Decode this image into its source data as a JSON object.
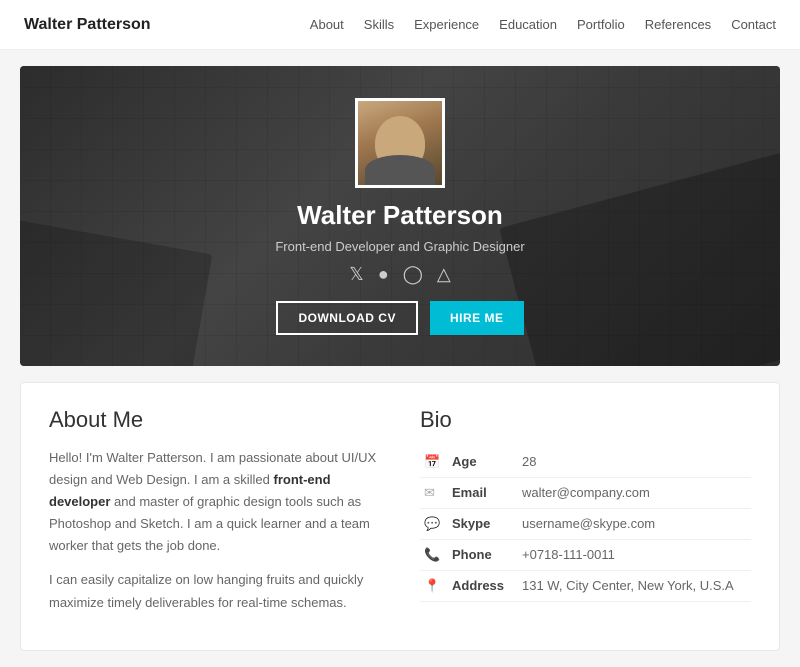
{
  "nav": {
    "brand": "Walter Patterson",
    "links": [
      "About",
      "Skills",
      "Experience",
      "Education",
      "Portfolio",
      "References",
      "Contact"
    ]
  },
  "hero": {
    "name": "Walter Patterson",
    "title": "Front-end Developer and Graphic Designer",
    "socials": [
      "𝕏",
      "f",
      "◎",
      "⌬"
    ],
    "btn_cv": "DOWNLOAD CV",
    "btn_hire": "HIRE ME"
  },
  "about": {
    "title": "About Me",
    "para1_start": "Hello! I'm Walter Patterson. I am passionate about UI/UX design and Web Design. I am a skilled ",
    "bold": "front-end developer",
    "para1_end": " and master of graphic design tools such as Photoshop and Sketch. I am a quick learner and a team worker that gets the job done.",
    "para2": "I can easily capitalize on low hanging fruits and quickly maximize timely deliverables for real-time schemas."
  },
  "bio": {
    "title": "Bio",
    "rows": [
      {
        "icon": "📅",
        "label": "Age",
        "value": "28"
      },
      {
        "icon": "✉",
        "label": "Email",
        "value": "walter@company.com"
      },
      {
        "icon": "💬",
        "label": "Skype",
        "value": "username@skype.com"
      },
      {
        "icon": "📞",
        "label": "Phone",
        "value": "+0718-111-0011"
      },
      {
        "icon": "📍",
        "label": "Address",
        "value": "131 W, City Center, New York, U.S.A"
      }
    ]
  }
}
